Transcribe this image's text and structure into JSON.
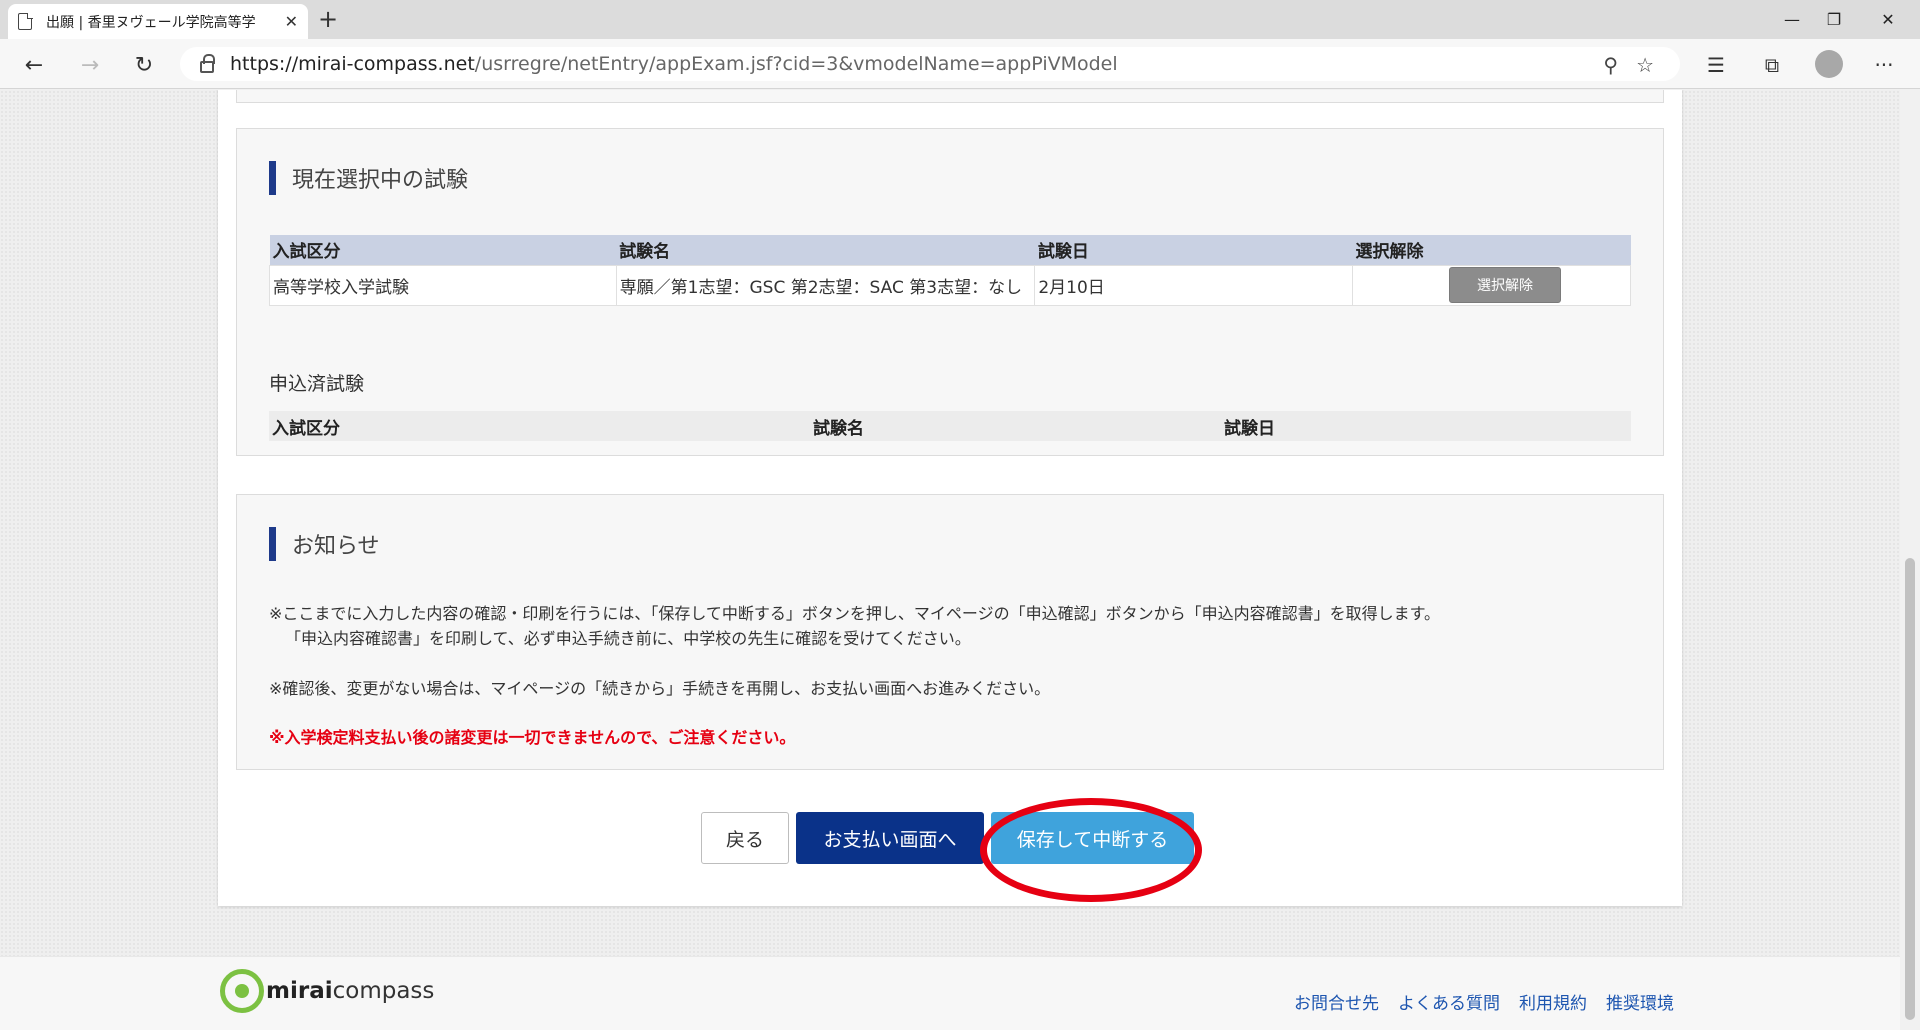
{
  "browser": {
    "tab_title": "出願 | 香里ヌヴェール学院高等学",
    "tab_close": "✕",
    "new_tab": "+",
    "url_host": "https://mirai-compass.net",
    "url_path": "/usrregre/netEntry/appExam.jsf?cid=3&vmodelName=appPiVModel",
    "minimize": "—",
    "maximize": "❐",
    "close": "✕",
    "back": "←",
    "forward": "→",
    "refresh": "↻",
    "more": "···"
  },
  "exam_section": {
    "title": "現在選択中の試験",
    "columns": [
      "入試区分",
      "試験名",
      "試験日",
      "選択解除"
    ],
    "rows": [
      {
        "category": "高等学校入学試験",
        "name": "専願／第1志望：GSC 第2志望：SAC 第3志望：なし",
        "date": "2月10日",
        "action_label": "選択解除"
      }
    ]
  },
  "applied_section": {
    "title": "申込済試験",
    "columns": [
      "入試区分",
      "試験名",
      "試験日"
    ]
  },
  "notice_section": {
    "title": "お知らせ",
    "line1": "※ここまでに入力した内容の確認・印刷を行うには、「保存して中断する」ボタンを押し、マイページの「申込確認」ボタンから「申込内容確認書」を取得します。",
    "line2": "「申込内容確認書」を印刷して、必ず申込手続き前に、中学校の先生に確認を受けてください。",
    "line3": "※確認後、変更がない場合は、マイページの「続きから」手続きを再開し、お支払い画面へお進みください。",
    "warning": "※入学検定料支払い後の諸変更は一切できませんので、ご注意ください。"
  },
  "actions": {
    "back_label": "戻る",
    "pay_label": "お支払い画面へ",
    "save_label": "保存して中断する"
  },
  "footer": {
    "logo_bold": "mirai",
    "logo_rest": "compass",
    "links": [
      "お問合せ先",
      "よくある質問",
      "利用規約",
      "推奨環境"
    ]
  },
  "colors": {
    "accent_navy": "#0a3289",
    "save_blue": "#3fa3dc",
    "highlight_red": "#e60012",
    "logo_green": "#7cc142"
  }
}
